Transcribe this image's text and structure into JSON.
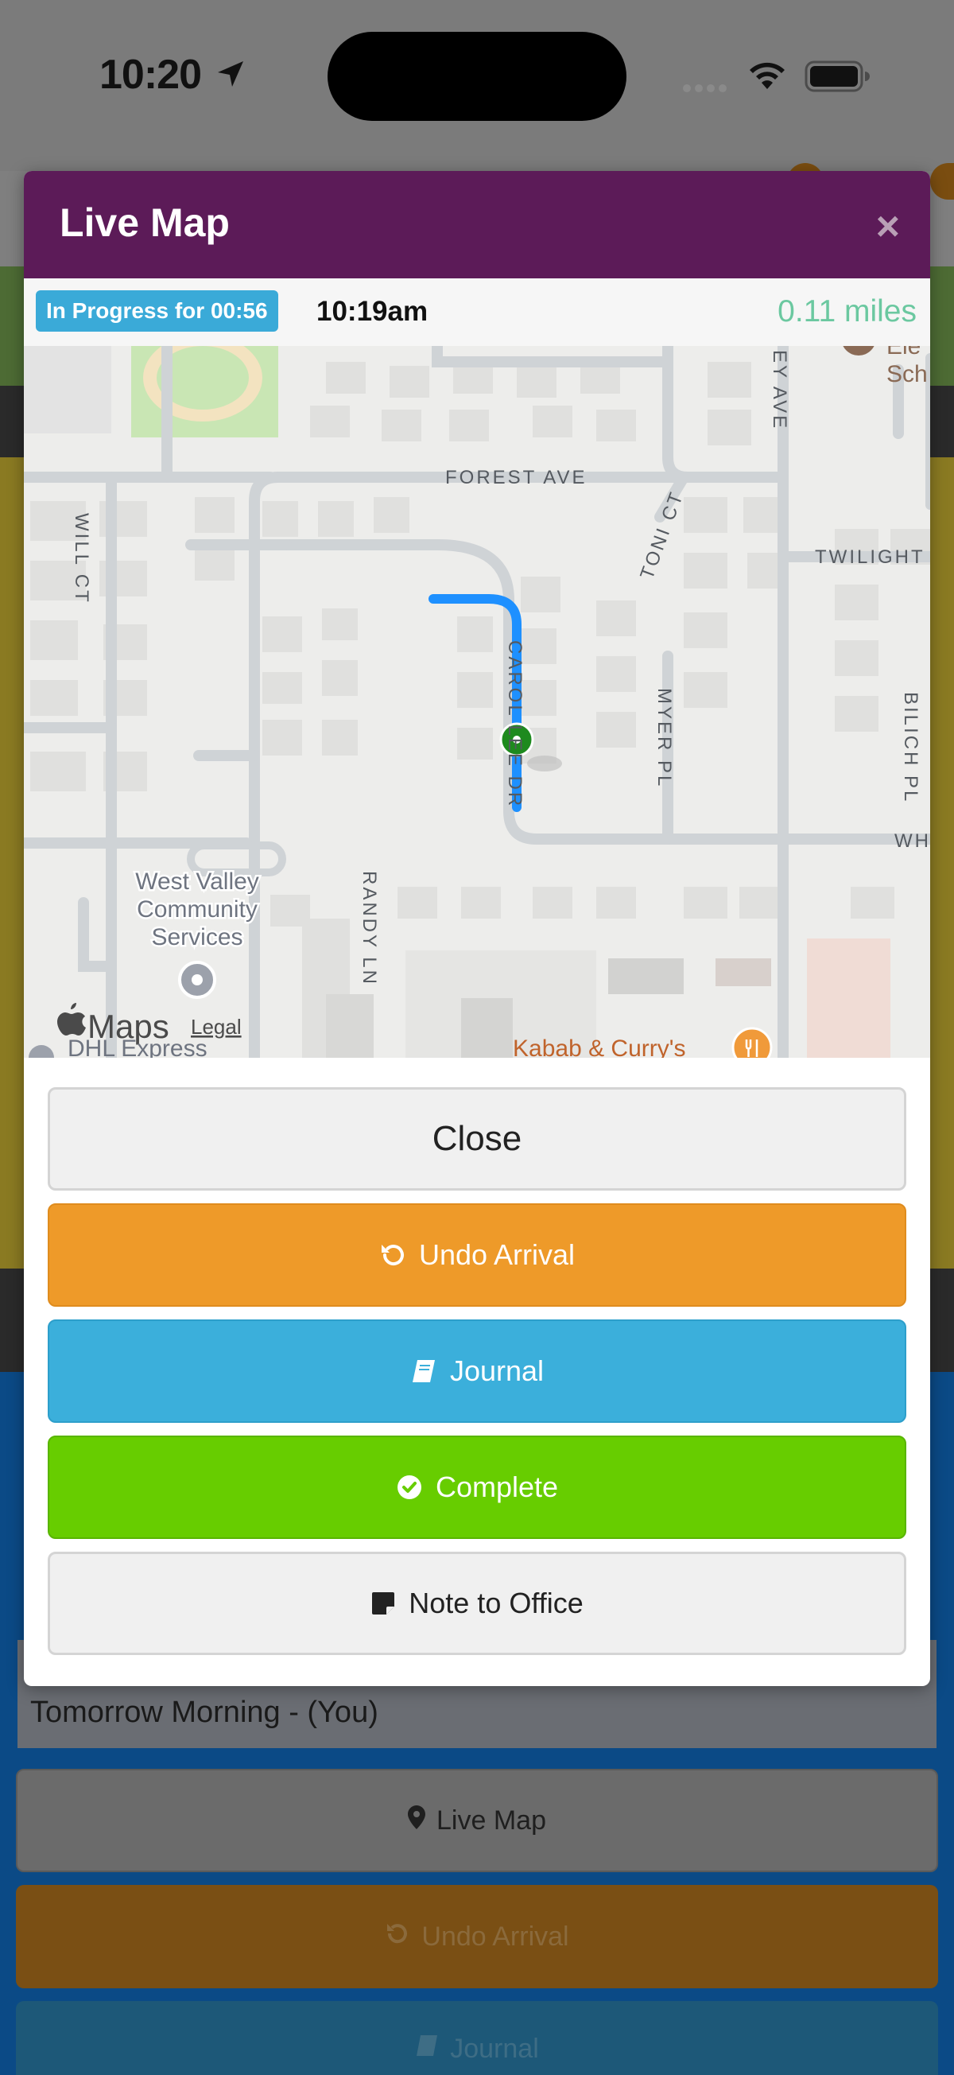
{
  "status_bar": {
    "time": "10:20"
  },
  "modal": {
    "title": "Live Map",
    "close_symbol": "×",
    "progress_label": "In Progress for 00:56",
    "time": "10:19am",
    "distance": "0.11 miles",
    "buttons": {
      "close": "Close",
      "undo_arrival": "Undo Arrival",
      "journal": "Journal",
      "complete": "Complete",
      "note": "Note to Office"
    }
  },
  "map": {
    "streets": [
      "FOREST AVE",
      "WILL CT",
      "TONI CT",
      "TWILIGHT",
      "CAROL LEE DR",
      "MYER PL",
      "BILICH PL",
      "RANDY LN",
      "EY AVE",
      "WH"
    ],
    "poi": {
      "west_valley_line1": "West Valley",
      "west_valley_line2": "Community",
      "west_valley_line3": "Services",
      "school_line1": "Ele",
      "school_line2": "Sch",
      "dhl": "DHL Express",
      "kabab": "Kabab & Curry's"
    },
    "brand": "Maps",
    "legal": "Legal"
  },
  "background": {
    "section_title": "Tomorrow Morning - (You)",
    "live_map": "Live Map",
    "undo_arrival": "Undo Arrival",
    "journal": "Journal"
  },
  "icons": {
    "location_arrow": "location-arrow-icon",
    "wifi": "wifi-icon",
    "battery": "battery-icon",
    "undo": "undo-icon",
    "journal": "book-icon",
    "complete": "check-circle-icon",
    "note": "sticky-note-icon",
    "map_pin": "map-marker-icon"
  },
  "colors": {
    "header": "#5c1b58",
    "progress_badge": "#3aaad8",
    "distance": "#6bc8a0",
    "undo": "#ee9a29",
    "journal": "#3bafdb",
    "complete": "#67cd00",
    "route": "#1e90ff",
    "location_dot": "#1e8a1e"
  }
}
